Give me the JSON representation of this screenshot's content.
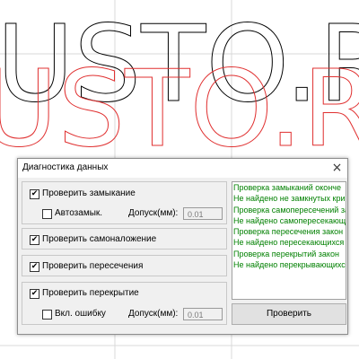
{
  "background": {
    "text_black": "USTO.R",
    "text_red": "USTO.R",
    "colors": {
      "black_outline": "#000000",
      "red_outline": "#e03030",
      "grid": "#d8d8d8"
    }
  },
  "dialog": {
    "title": "Диагностика данных",
    "close_icon": "×",
    "groups": [
      {
        "checkbox_label": "Проверить замыкание",
        "checked": true,
        "sub_checkbox_label": "Автозамык.",
        "sub_checked": false,
        "tolerance_label": "Допуск(мм):",
        "tolerance_value": "0.01"
      },
      {
        "checkbox_label": "Проверить самоналожение",
        "checked": true
      },
      {
        "checkbox_label": "Проверить пересечения",
        "checked": true
      },
      {
        "checkbox_label": "Проверить перекрытие",
        "checked": true,
        "sub_checkbox_label": "Вкл. ошибку",
        "sub_checked": false,
        "tolerance_label": "Допуск(мм):",
        "tolerance_value": "0.01"
      }
    ],
    "log_lines": [
      "Проверка замыканий оконче",
      "Не найдено не замкнутых кри",
      "Проверка самопересечений за",
      "Не найдено самопересекающ",
      "Проверка пересечения закон",
      "Не найдено пересекающихся",
      "Проверка перекрытий закон",
      "Не найдено перекрывающихс"
    ],
    "log_color": "#008000",
    "check_button_label": "Проверить"
  }
}
